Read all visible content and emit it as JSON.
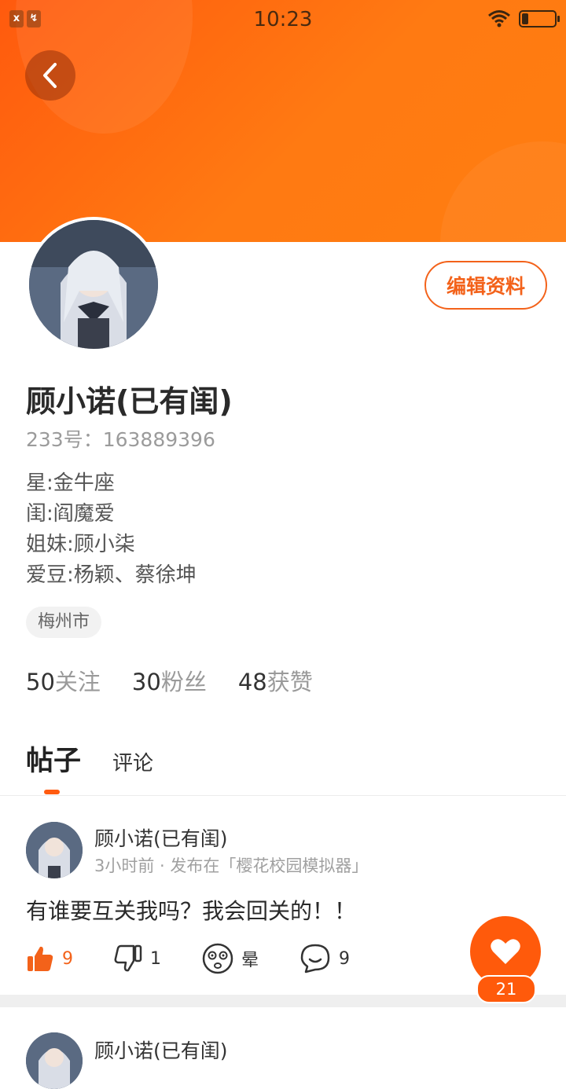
{
  "status_bar": {
    "time": "10:23",
    "left_icons": [
      "x",
      "↯"
    ]
  },
  "header": {
    "back_label": "<"
  },
  "profile": {
    "edit_label": "编辑资料",
    "username": "顾小诺(已有闺)",
    "account_id": "233号：163889396",
    "bio_lines": [
      "星:金牛座",
      "闺:阎魔爱",
      "姐妹:顾小柒",
      "爱豆:杨颖、蔡徐坤"
    ],
    "location": "梅州市",
    "stats": [
      {
        "number": "50",
        "label": "关注"
      },
      {
        "number": "30",
        "label": "粉丝"
      },
      {
        "number": "48",
        "label": "获赞"
      }
    ]
  },
  "tabs": {
    "active": "帖子",
    "other": "评论"
  },
  "posts": [
    {
      "author": "顾小诺(已有闺)",
      "meta": "3小时前 · 发布在「樱花校园模拟器」",
      "content": "有谁要互关我吗？我会回关的！！",
      "actions": {
        "likes": "9",
        "dislikes": "1",
        "dizzy_label": "晕",
        "comments": "9"
      }
    },
    {
      "author": "顾小诺(已有闺)"
    }
  ],
  "fab": {
    "count": "21"
  },
  "colors": {
    "accent": "#ff5a0b",
    "banner": "#ff7a12"
  }
}
